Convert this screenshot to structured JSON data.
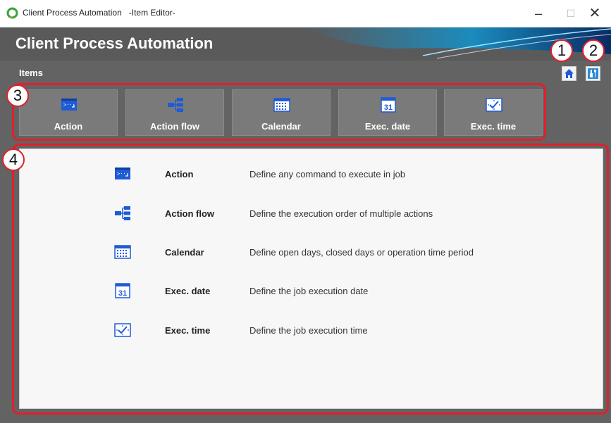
{
  "window": {
    "title": "Client Process Automation   -Item Editor-",
    "minimize_glyph": "–",
    "maximize_glyph": "☐",
    "close_glyph": "✕"
  },
  "app": {
    "title": "Client Process Automation"
  },
  "items_label": "Items",
  "toolbar_items": [
    {
      "label": "Action",
      "icon": "action-icon"
    },
    {
      "label": "Action flow",
      "icon": "action-flow-icon"
    },
    {
      "label": "Calendar",
      "icon": "calendar-icon"
    },
    {
      "label": "Exec. date",
      "icon": "exec-date-icon"
    },
    {
      "label": "Exec. time",
      "icon": "exec-time-icon"
    }
  ],
  "descriptions": [
    {
      "name": "Action",
      "text": "Define any command to execute in job"
    },
    {
      "name": "Action flow",
      "text": "Define the execution order of multiple actions"
    },
    {
      "name": "Calendar",
      "text": "Define open days, closed days or operation time period"
    },
    {
      "name": "Exec. date",
      "text": "Define the job execution date"
    },
    {
      "name": "Exec. time",
      "text": "Define the job execution time"
    }
  ],
  "calendar_day": "31",
  "callouts": [
    "1",
    "2",
    "3",
    "4"
  ],
  "colors": {
    "highlight": "#e0202a",
    "icon_blue": "#1f5bd6",
    "header_bg": "#5a5a5a"
  }
}
